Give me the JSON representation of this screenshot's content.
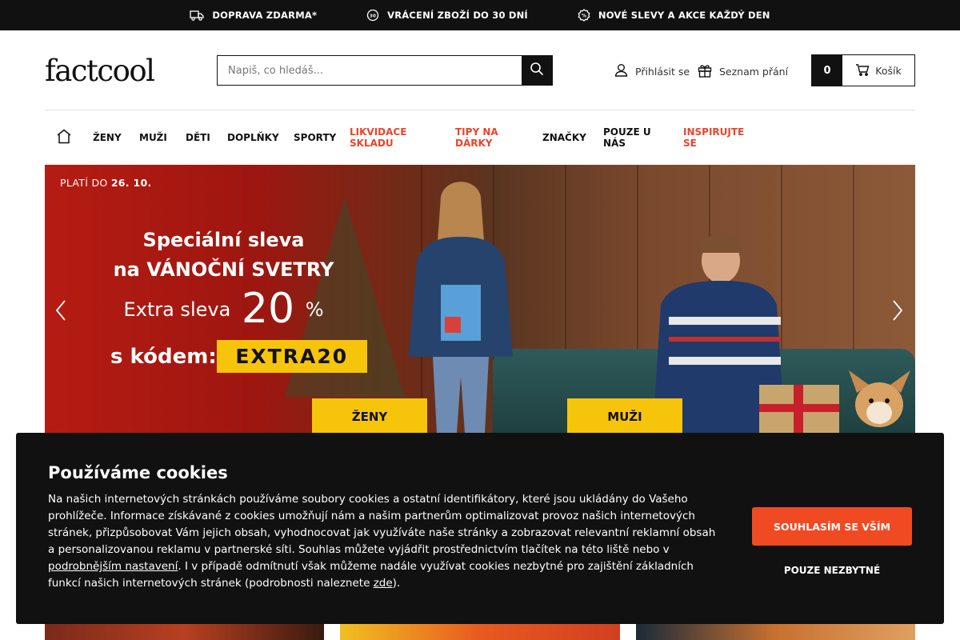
{
  "topbar": {
    "items": [
      {
        "icon": "truck-icon",
        "label": "DOPRAVA ZDARMA*"
      },
      {
        "icon": "return-icon",
        "label": "VRÁCENÍ ZBOŽÍ DO 30 DNÍ"
      },
      {
        "icon": "discount-icon",
        "label": "NOVÉ SLEVY A AKCE KAŽDÝ DEN"
      }
    ]
  },
  "header": {
    "logo": "factcool",
    "search_placeholder": "Napiš, co hledáš...",
    "login": "Přihlásit se",
    "wishlist": "Seznam přání",
    "cart_count": "0",
    "cart_label": "Košík"
  },
  "nav": {
    "items": [
      {
        "label": "ŽENY",
        "highlight": false
      },
      {
        "label": "MUŽI",
        "highlight": false
      },
      {
        "label": "DĚTI",
        "highlight": false
      },
      {
        "label": "DOPLŇKY",
        "highlight": false
      },
      {
        "label": "SPORTY",
        "highlight": false
      },
      {
        "label": "LIKVIDACE SKLADU",
        "highlight": true
      },
      {
        "label": "TIPY NA DÁRKY",
        "highlight": true
      },
      {
        "label": "ZNAČKY",
        "highlight": false
      },
      {
        "label": "POUZE U NÁS",
        "highlight": false
      },
      {
        "label": "INSPIRUJTE SE",
        "highlight": true
      }
    ],
    "highlight_color": "#e8452a"
  },
  "hero": {
    "valid_prefix": "PLATÍ DO",
    "valid_date": "26. 10.",
    "line1": "Speciální sleva",
    "line2": "na VÁNOČNÍ SVETRY",
    "extra_prefix": "Extra sleva",
    "extra_value": "20",
    "extra_unit": "%",
    "code_prefix": "s kódem:",
    "code": "EXTRA20",
    "btn_women": "ŽENY",
    "btn_men": "MUŽI",
    "accent_color": "#f6c40b"
  },
  "cookie": {
    "title": "Používáme cookies",
    "text_1": "Na našich internetových stránkách používáme soubory cookies a ostatní identifikátory, které jsou ukládány do Vašeho prohlížeče. Informace získávané z cookies umožňují nám a našim partnerům optimalizovat provoz našich internetových stránek, přizpůsobovat Vám jejich obsah, vyhodnocovat jak využíváte naše stránky a zobrazovat relevantní reklamní obsah a personalizovanou reklamu v partnerské síti. Souhlas můžete vyjádřit prostřednictvím tlačítek na této liště nebo v ",
    "link_settings": "podrobnějším nastavení",
    "text_2": ". I v případě odmítnutí však můžeme nadále využívat cookies nezbytné pro zajištění základních funkcí našich internetových stránek (podrobnosti naleznete ",
    "link_here": "zde",
    "text_3": ").",
    "accept": "SOUHLASÍM SE VŠÍM",
    "necessary": "POUZE NEZBYTNÉ",
    "accept_color": "#f04a23"
  }
}
